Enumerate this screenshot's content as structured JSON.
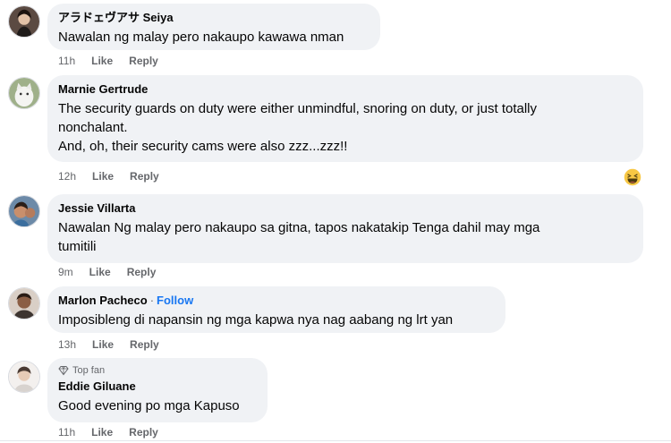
{
  "comments": [
    {
      "author": "アラドェヴアサ Seiya",
      "text": [
        "Nawalan ng malay pero nakaupo kawawa nman"
      ],
      "time": "11h",
      "like": "Like",
      "reply": "Reply",
      "avatar": "avatar-person-dark"
    },
    {
      "author": "Marnie Gertrude",
      "text": [
        "The security guards on duty were either unmindful, snoring on duty, or just totally",
        "nonchalant.",
        "And, oh, their security cams were also zzz...zzz!!"
      ],
      "time": "12h",
      "like": "Like",
      "reply": "Reply",
      "avatar": "avatar-cat",
      "reaction": "haha-emoji-icon"
    },
    {
      "author": "Jessie Villarta",
      "text": [
        "Nawalan Ng malay pero nakaupo sa gitna, tapos nakatakip Tenga dahil may mga",
        "tumitili"
      ],
      "time": "9m",
      "like": "Like",
      "reply": "Reply",
      "avatar": "avatar-child"
    },
    {
      "author": "Marlon Pacheco",
      "separator": "·",
      "follow": "Follow",
      "text": [
        "Imposibleng di napansin ng mga kapwa nya nag aabang ng lrt yan"
      ],
      "time": "13h",
      "like": "Like",
      "reply": "Reply",
      "avatar": "avatar-person"
    },
    {
      "badge": "Top fan",
      "author": "Eddie Giluane",
      "text": [
        "Good evening po mga Kapuso"
      ],
      "time": "11h",
      "like": "Like",
      "reply": "Reply",
      "avatar": "avatar-person-light"
    }
  ],
  "colors": {
    "bubble": "#f0f2f5",
    "meta": "#65676b",
    "link": "#1877f2"
  }
}
